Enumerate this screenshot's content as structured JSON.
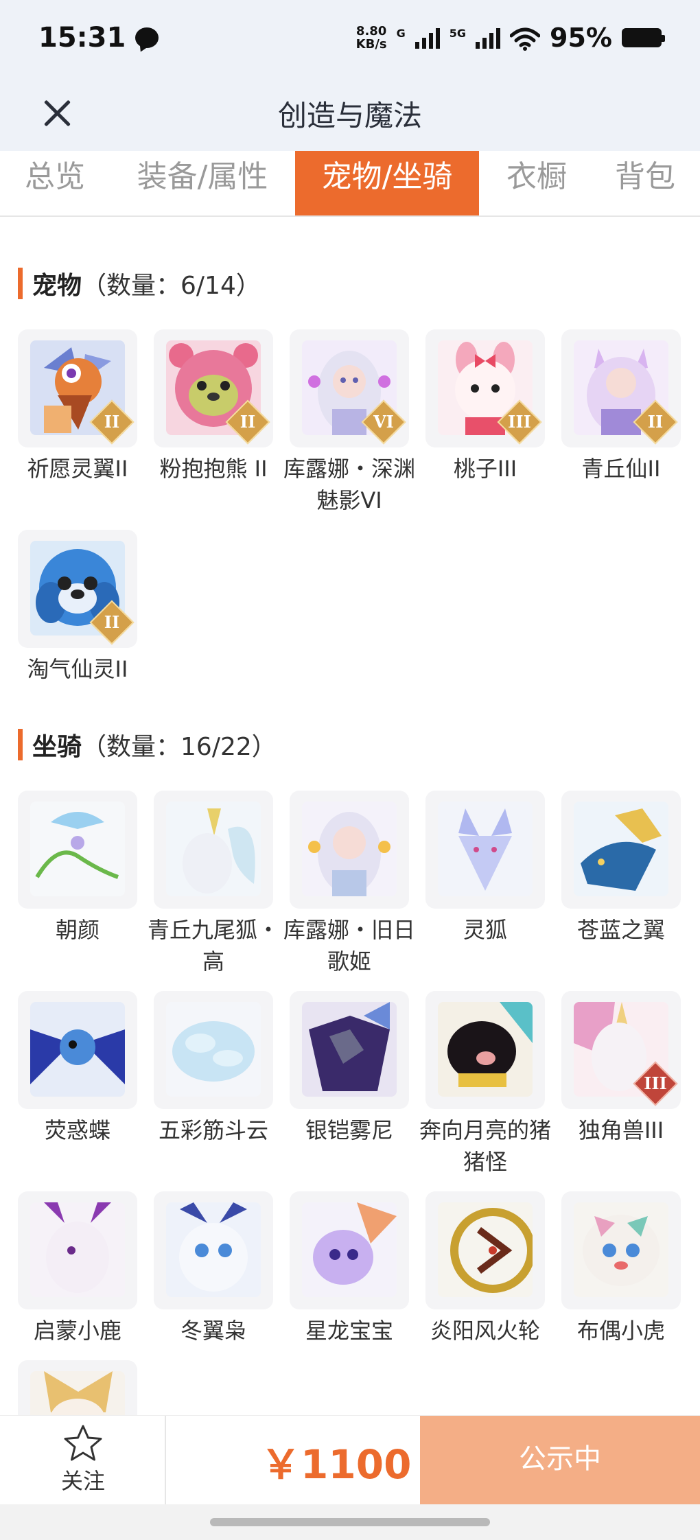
{
  "status_bar": {
    "time": "15:31",
    "net_speed_value": "8.80",
    "net_speed_unit": "KB/s",
    "net_type_1": "G",
    "net_type_2": "5G",
    "battery": "95%"
  },
  "header": {
    "title": "创造与魔法"
  },
  "tabs": [
    {
      "label": "总览",
      "active": false
    },
    {
      "label": "装备/属性",
      "active": false
    },
    {
      "label": "宠物/坐骑",
      "active": true
    },
    {
      "label": "衣橱",
      "active": false
    },
    {
      "label": "背包",
      "active": false
    }
  ],
  "pets": {
    "title": "宠物",
    "count": "（数量：6/14）",
    "items": [
      {
        "name": "祈愿灵翼II",
        "badge": "II",
        "icon": "griffin-pet"
      },
      {
        "name": "粉抱抱熊 II",
        "badge": "II",
        "icon": "pink-bear-pet"
      },
      {
        "name": "库露娜・深渊魅影VI",
        "badge": "VI",
        "icon": "white-hair-girl-pet"
      },
      {
        "name": "桃子III",
        "badge": "III",
        "icon": "pink-bunny-pet"
      },
      {
        "name": "青丘仙II",
        "badge": "II",
        "icon": "fox-fairy-pet"
      },
      {
        "name": "淘气仙灵II",
        "badge": "II",
        "icon": "blue-puppy-pet"
      }
    ]
  },
  "mounts": {
    "title": "坐骑",
    "count": "（数量：16/22）",
    "items": [
      {
        "name": "朝颜",
        "badge": "",
        "icon": "vine-bird-mount"
      },
      {
        "name": "青丘九尾狐・高",
        "badge": "",
        "icon": "nine-tail-fox-mount"
      },
      {
        "name": "库露娜・旧日歌姬",
        "badge": "",
        "icon": "songstress-mount"
      },
      {
        "name": "灵狐",
        "badge": "",
        "icon": "spirit-fox-mount"
      },
      {
        "name": "苍蓝之翼",
        "badge": "",
        "icon": "blue-dragon-mount"
      },
      {
        "name": "荧惑蝶",
        "badge": "",
        "icon": "butterfly-mount"
      },
      {
        "name": "五彩筋斗云",
        "badge": "",
        "icon": "cloud-mount"
      },
      {
        "name": "银铠雾尼",
        "badge": "",
        "icon": "armored-beast-mount"
      },
      {
        "name": "奔向月亮的猪猪怪",
        "badge": "",
        "icon": "pig-mount"
      },
      {
        "name": "独角兽III",
        "badge": "III",
        "icon": "unicorn-mount"
      },
      {
        "name": "启蒙小鹿",
        "badge": "",
        "icon": "white-deer-mount"
      },
      {
        "name": "冬翼枭",
        "badge": "",
        "icon": "snow-owl-mount"
      },
      {
        "name": "星龙宝宝",
        "badge": "",
        "icon": "baby-dragon-mount"
      },
      {
        "name": "炎阳风火轮",
        "badge": "",
        "icon": "fire-wheel-mount"
      },
      {
        "name": "布偶小虎",
        "badge": "",
        "icon": "tiger-mount"
      },
      {
        "name": "",
        "badge": "",
        "icon": "partial-mount"
      }
    ]
  },
  "bottom_bar": {
    "follow_label": "关注",
    "price": "￥1100",
    "status_button": "公示中"
  },
  "colors": {
    "accent": "#ec6b2d",
    "status_button_bg": "#f4ae86",
    "header_bg": "#eef2f8"
  }
}
